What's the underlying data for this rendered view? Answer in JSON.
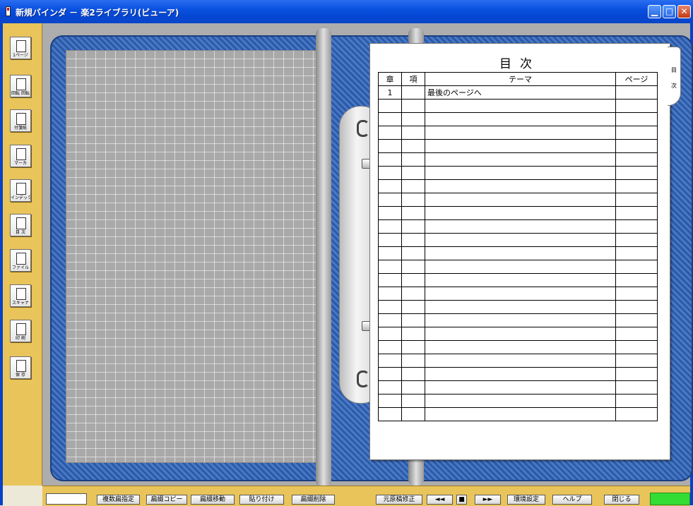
{
  "window": {
    "title": "新規バインダ － 楽2ライブラリ(ビューア)",
    "buttons": {
      "minimize": "▁",
      "maximize": "□",
      "close": "✕"
    }
  },
  "sidebar": {
    "tools": [
      {
        "name": "one-page-tool",
        "label": "1ページ",
        "icon": "page-icon"
      },
      {
        "name": "rotate-tool",
        "label": "回転 回転",
        "icon": "rotate-icon"
      },
      {
        "name": "sticky-note-tool",
        "label": "付箋紙",
        "icon": "sticky-note-icon"
      },
      {
        "name": "marker-tool",
        "label": "マーカ",
        "icon": "marker-icon"
      },
      {
        "name": "index-tool",
        "label": "インデックス",
        "icon": "index-icon"
      },
      {
        "name": "toc-tool",
        "label": "目 次",
        "icon": "toc-icon"
      },
      {
        "name": "file-tool",
        "label": "ファイル",
        "icon": "file-icon"
      },
      {
        "name": "scanner-tool",
        "label": "スキャナ",
        "icon": "scanner-icon"
      },
      {
        "name": "print-tool",
        "label": "印 刷",
        "icon": "print-icon"
      },
      {
        "name": "save-tool",
        "label": "保 存",
        "icon": "save-icon"
      }
    ]
  },
  "toc": {
    "title": "目次",
    "tab_label": [
      "目",
      "次"
    ],
    "columns": [
      "章",
      "項",
      "テーマ",
      "ページ"
    ],
    "rows": [
      [
        "1",
        "",
        "最後のページへ",
        ""
      ]
    ],
    "empty_rows": 24
  },
  "bottombar": {
    "page_input": "",
    "buttons": [
      "複数扁指定",
      "扁綴コピー",
      "扁綴移動",
      "貼り付け",
      "扁綴削除",
      "元原稿修正",
      "◄◄",
      "■",
      "►►",
      "環境設定",
      "ヘルプ",
      "閉じる"
    ]
  },
  "colors": {
    "titlebar": "#0A51E0",
    "sidebar": "#E8C45A",
    "binder_cover": "#2A5AA8",
    "status_indicator": "#33DD33"
  }
}
